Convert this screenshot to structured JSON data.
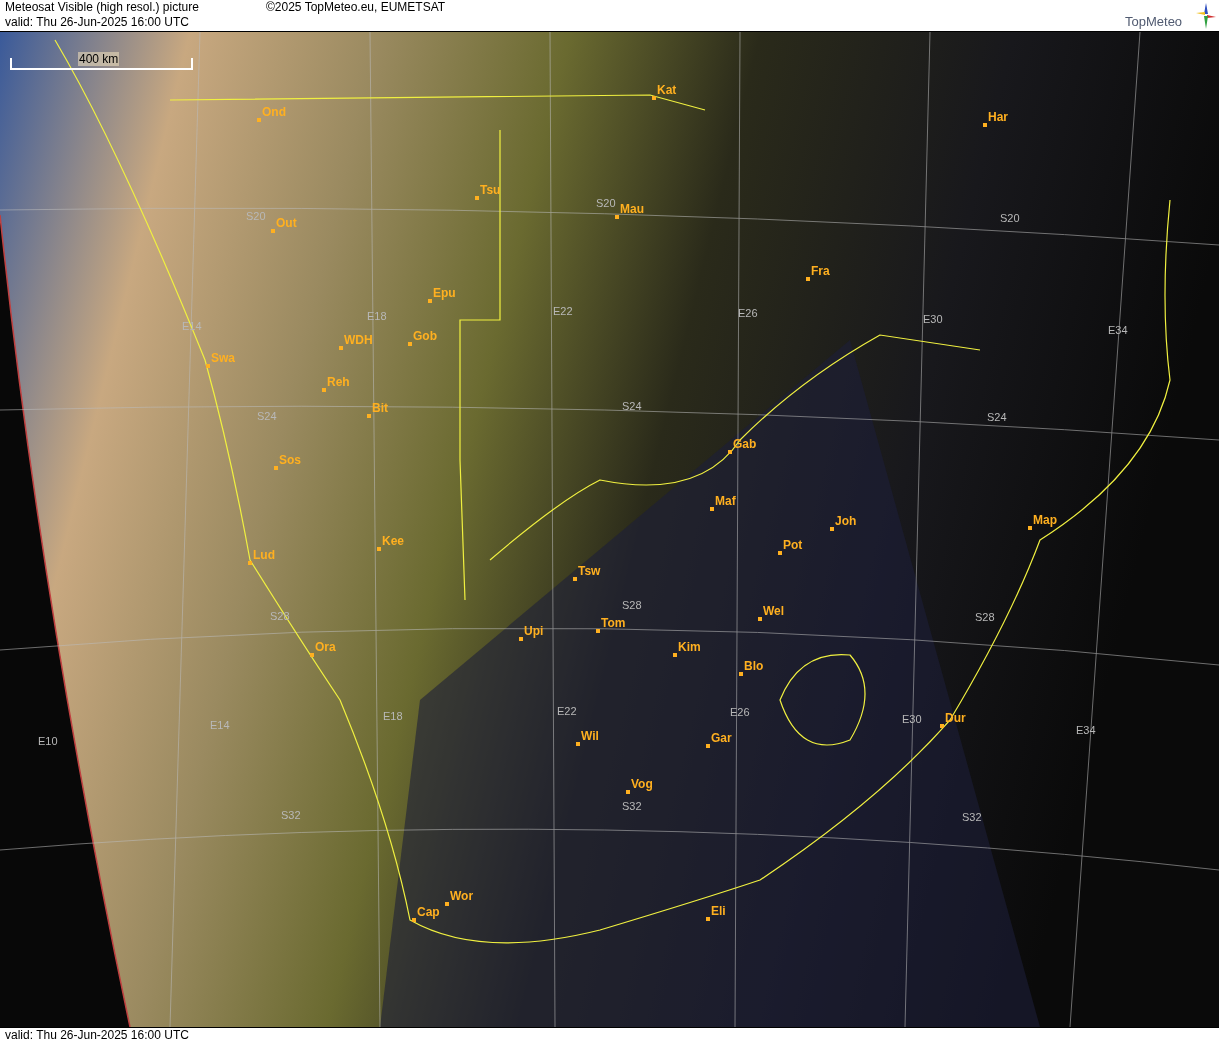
{
  "header": {
    "title": "Meteosat Visible (high resol.) picture",
    "copyright": "©2025 TopMeteo.eu, EUMETSAT",
    "valid": "valid:  Thu  26-Jun-2025  16:00 UTC",
    "logo": "TopMeteo"
  },
  "map": {
    "scale": "400 km",
    "cities": [
      {
        "label": "Kat"
      },
      {
        "label": "Har"
      },
      {
        "label": "Ond"
      },
      {
        "label": "Tsu"
      },
      {
        "label": "Mau"
      },
      {
        "label": "Out"
      },
      {
        "label": "Fra"
      },
      {
        "label": "Epu"
      },
      {
        "label": "WDH"
      },
      {
        "label": "Gob"
      },
      {
        "label": "Swa"
      },
      {
        "label": "Reh"
      },
      {
        "label": "Bit"
      },
      {
        "label": "Gab"
      },
      {
        "label": "Sos"
      },
      {
        "label": "Maf"
      },
      {
        "label": "Joh"
      },
      {
        "label": "Map"
      },
      {
        "label": "Kee"
      },
      {
        "label": "Pot"
      },
      {
        "label": "Lud"
      },
      {
        "label": "Tsw"
      },
      {
        "label": "Wel"
      },
      {
        "label": "Tom"
      },
      {
        "label": "Upi"
      },
      {
        "label": "Ora"
      },
      {
        "label": "Kim"
      },
      {
        "label": "Blo"
      },
      {
        "label": "Dur"
      },
      {
        "label": "Wil"
      },
      {
        "label": "Gar"
      },
      {
        "label": "Vog"
      },
      {
        "label": "Wor"
      },
      {
        "label": "Cap"
      },
      {
        "label": "Eli"
      }
    ],
    "grid_labels": [
      "S20",
      "S20",
      "S20",
      "E14",
      "E18",
      "E22",
      "E26",
      "E30",
      "E34",
      "S24",
      "S24",
      "S24",
      "S28",
      "S28",
      "S28",
      "E14",
      "E18",
      "E22",
      "E26",
      "E30",
      "E34",
      "E10",
      "S32",
      "S32",
      "S32"
    ]
  },
  "footer": {
    "valid": "valid:  Thu  26-Jun-2025  16:00 UTC"
  }
}
